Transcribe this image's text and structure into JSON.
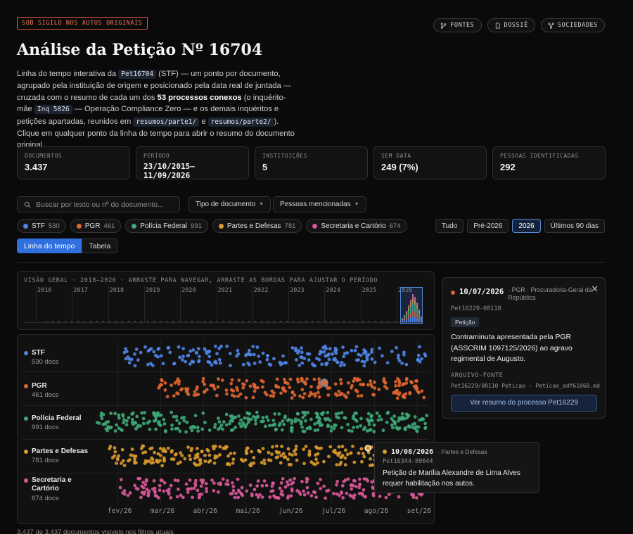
{
  "header": {
    "badge": "SOB SIGILO NOS AUTOS ORIGINAIS",
    "title": "Análise da Petição Nº 16704",
    "buttons": [
      {
        "label": "FONTES",
        "icon": "branch-icon"
      },
      {
        "label": "DOSSIÊ",
        "icon": "document-icon"
      },
      {
        "label": "SOCIEDADES",
        "icon": "network-icon"
      }
    ]
  },
  "intro": {
    "p1": "Linha do tempo interativa da ",
    "code1": "Pet16704",
    "p2": " (STF) — um ponto por documento, agrupado pela instituição de origem e posicionado pela data real de juntada — cruzada com o resumo de cada um dos ",
    "bold1": "53 processos conexos",
    "p3": " (o inquérito-mãe ",
    "code2": "Inq 5026",
    "p4": " — Operação Compliance Zero — e os demais inquéritos e petições apartadas, reunidos em ",
    "code3": "resumos/parte1/",
    "p5": " e ",
    "code4": "resumos/parte2/",
    "p6": "). Clique em qualquer ponto da linha do tempo para abrir o resumo do documento original."
  },
  "stats": [
    {
      "label": "DOCUMENTOS",
      "value": "3.437"
    },
    {
      "label": "PERÍODO",
      "value": "23/10/2015–11/09/2026"
    },
    {
      "label": "INSTITUIÇÕES",
      "value": "5"
    },
    {
      "label": "SEM DATA",
      "value": "249 (7%)"
    },
    {
      "label": "PESSOAS IDENTIFICADAS",
      "value": "292"
    }
  ],
  "filters": {
    "search_placeholder": "Buscar por texto ou nº do documento...",
    "type_label": "Tipo de documento",
    "people_label": "Pessoas mencionadas"
  },
  "institutions": [
    {
      "name": "STF",
      "count": "530",
      "color": "#4f86e8",
      "docs": "530 docs"
    },
    {
      "name": "PGR",
      "count": "461",
      "color": "#e0662f",
      "docs": "461 docs"
    },
    {
      "name": "Polícia Federal",
      "count": "991",
      "color": "#3fa877",
      "docs": "991 docs"
    },
    {
      "name": "Partes e Defesas",
      "count": "781",
      "color": "#d99a2e",
      "docs": "781 docs"
    },
    {
      "name": "Secretaria e Cartório",
      "count": "674",
      "color": "#d9589a",
      "docs": "674 docs"
    }
  ],
  "ranges": [
    "Tudo",
    "Pré-2026",
    "2026",
    "Últimos 90 dias"
  ],
  "view_tabs": [
    "Linha do tempo",
    "Tabela"
  ],
  "overview": {
    "title": "VISÃO GERAL · 2018–2026 · ARRASTE PARA NAVEGAR, ARRASTE AS BORDAS PARA AJUSTAR O PERÍODO",
    "years": [
      "2016",
      "2017",
      "2018",
      "2019",
      "2020",
      "2021",
      "2022",
      "2023",
      "2024",
      "2025",
      "2026"
    ]
  },
  "timeline": {
    "months": [
      "fev/26",
      "mar/26",
      "abr/26",
      "mai/26",
      "jun/26",
      "jul/26",
      "ago/26",
      "set/26"
    ]
  },
  "tooltip": {
    "date": "10/08/2026",
    "institution": "· Partes e Defesas",
    "id": "Pet16344-00044",
    "text": "Petição de Marília Alexandre de Lima Alves requer habilitação nos autos."
  },
  "detail": {
    "date": "10/07/2026",
    "institution": "· PGR · Procuradoria-Geral da República",
    "id": "Pet16229-00110",
    "tag": "Petição",
    "text": "Contraminuta apresentada pela PGR (ASSCRIM 1097125/2026) ao agravo regimental de Augusto.",
    "source_label": "ARQUIVO-FONTE",
    "source": "Pet16229/00110 Peticao - Peticao_edf61068.md",
    "button": "Ver resumo do processo Pet16229"
  },
  "footer": "3.437 de 3.437 documentos visíveis nos filtros atuais"
}
